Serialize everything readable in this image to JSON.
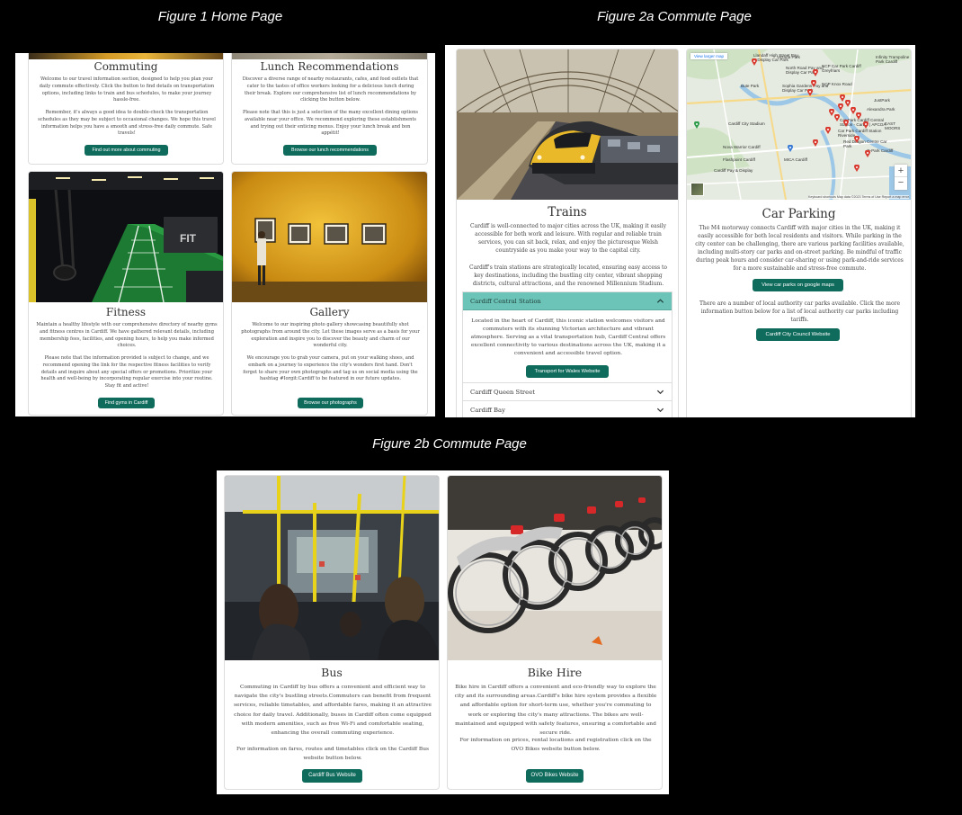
{
  "figures": {
    "fig1": "Figure 1 Home Page",
    "fig2a": "Figure 2a Commute Page",
    "fig2b": "Figure 2b Commute Page"
  },
  "home": {
    "commuting": {
      "title": "Commuting",
      "p1": "Welcome to our travel information section, designed to help you plan your daily commute effectively. Click the button to find details on transportation options, including links to train and bus schedules, to make your journey hassle-free.",
      "p2": "Remember, it's always a good idea to double-check the transportation schedules as they may be subject to occasional changes. We hope this travel information helps you have a smooth and stress-free daily commute. Safe travels!",
      "button": "Find out more about commuting"
    },
    "lunch": {
      "title": "Lunch Recommendations",
      "p1": "Discover a diverse range of nearby restaurants, cafes, and food outlets that cater to the tastes of office workers looking for a delicious lunch during their break. Explore our comprehensive list of lunch recommendations by clicking the button below.",
      "p2": "Please note that this is just a selection of the many excellent dining options available near your office. We recommend exploring these establishments and trying out their enticing menus. Enjoy your lunch break and bon appétit!",
      "button": "Browse our lunch recommendations"
    },
    "fitness": {
      "title": "Fitness",
      "p1": "Maintain a healthy lifestyle with our comprehensive directory of nearby gyms and fitness centres in Cardiff. We have gathered relevant details, including membership fees, facilities, and opening hours, to help you make informed choices.",
      "p2": "Please note that the information provided is subject to change, and we recommend opening the link for the respective fitness facilities to verify details and inquire about any special offers or promotions. Prioritize your health and well-being by incorporating regular exercise into your routine. Stay fit and active!",
      "button": "Find gyms in Cardiff",
      "gym_sign": "FIT"
    },
    "gallery": {
      "title": "Gallery",
      "p1": "Welcome to our inspiring photo gallery showcasing beautifully shot photographs from around the city. Let these images serve as a basis for your exploration and inspire you to discover the beauty and charm of our wonderful city.",
      "p2": "We encourage you to grab your camera, put on your walking shoes, and embark on a journey to experience the city's wonders first hand. Don't forget to share your own photographs and tag us on social media using the hashtag #Iorgit:Cardiff to be featured in our future updates.",
      "button": "Browse our photographs"
    }
  },
  "commute": {
    "trains": {
      "title": "Trains",
      "p1": "Cardiff is well-connected to major cities across the UK, making it easily accessible for both work and leisure. With regular and reliable train services, you can sit back, relax, and enjoy the picturesque Welsh countryside as you make your way to the capital city.",
      "p2": "Cardiff's train stations are strategically located, ensuring easy access to key destinations, including the bustling city center, vibrant shopping districts, cultural attractions, and the renowned Millennium Stadium.",
      "accordion": [
        {
          "label": "Cardiff Central Station",
          "open": true
        },
        {
          "label": "Cardiff Queen Street",
          "open": false
        },
        {
          "label": "Cardiff Bay",
          "open": false
        }
      ],
      "central_text": "Located in the heart of Cardiff, this iconic station welcomes visitors and commuters with its stunning Victorian architecture and vibrant atmosphere. Serving as a vital transportation hub, Cardiff Central offers excellent connectivity to various destinations across the UK, making it a convenient and accessible travel option.",
      "button": "Transport for Wales Website"
    },
    "parking": {
      "title": "Car Parking",
      "p1": "The M4 motorway connects Cardiff with major cities in the UK, making it easily accessible for both local residents and visitors. While parking in the city center can be challenging, there are various parking facilities available, including multi-story car parks and on-street parking. Be mindful of traffic during peak hours and consider car-sharing or using park-and-ride services for a more sustainable and stress-free commute.",
      "button1": "View car parks on google maps",
      "p2": "There are a number of local authority car parks available. Click the more information button below for a list of local authority car parks including tariffs.",
      "button2": "Cardiff City Council Website",
      "map": {
        "view_larger": "View larger map",
        "labels": [
          "Llandaff High Street Pay & Display Car Park",
          "North Road Pay and Display Car Park",
          "NCP Car Park Cardiff Greyfriars",
          "Sophia Gardens Pay and Display Car Park",
          "NCP Knox Road",
          "Bute Park",
          "JustPark",
          "Car Park Cardiff Central Station - Cardiff | APCOA",
          "Cardiff City Stadium",
          "Car Park Cardiff Station Riverside",
          "Red Dragon Centre Car Park",
          "Q-Park Cardiff",
          "Nova Warrior Cardiff",
          "Alexandra Park",
          "Flashpoint Cardiff",
          "Cardiff Pay & Display",
          "MICA Cardiff",
          "EAST MOORS",
          "Victoria Park",
          "Infinity Trampoline Park Cardiff"
        ],
        "zoom_in": "+",
        "zoom_out": "−",
        "footer": "Keyboard shortcuts   Map data ©2023   Terms of Use   Report a map error"
      }
    },
    "bus": {
      "title": "Bus",
      "p1": "Commuting in Cardiff by bus offers a convenient and efficient way to navigate the city's bustling streets.Commuters can benefit from frequent services, reliable timetables, and affordable fares, making it an attractive choice for daily travel. Additionally, buses in Cardiff often come equipped with modern amenities, such as free Wi-Fi and comfortable seating, enhancing the overall commuting experience.",
      "p2": "For information on fares, routes and timetables click on the Cardiff Bus website button below.",
      "button": "Cardiff Bus Website"
    },
    "bike": {
      "title": "Bike Hire",
      "p1": "Bike hire in Cardiff offers a convenient and eco-friendly way to explore the city and its surrounding areas.Cardiff's bike hire system provides a flexible and affordable option for short-term use, whether you're commuting to work or exploring the city's many attractions. The bikes are well-maintained and equipped with safety features, ensuring a comfortable and secure ride.",
      "p2": "For information on prices, rental locations and registration click on the OVO Bikes website button below.",
      "button": "OVO Bikes Website"
    }
  },
  "colors": {
    "accent": "#0f6b5c",
    "accordion_active": "#6cc4b8"
  }
}
